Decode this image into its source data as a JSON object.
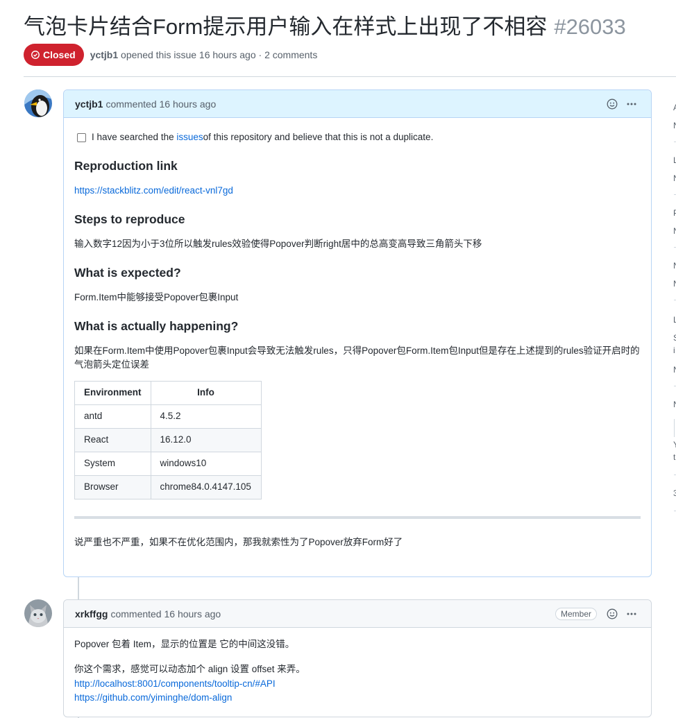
{
  "issue": {
    "title": "气泡卡片结合Form提示用户输入在样式上出现了不相容",
    "number": "#26033",
    "state": "Closed",
    "author": "yctjb1",
    "opened_text": "opened this issue 16 hours ago · 2 comments"
  },
  "comment1": {
    "author": "yctjb1",
    "time_text": "commented 16 hours ago",
    "checkbox": {
      "before": "I have searched the ",
      "link": "issues",
      "after": " of this repository and believe that this is not a duplicate."
    },
    "h_repro": "Reproduction link",
    "repro_link": "https://stackblitz.com/edit/react-vnl7gd",
    "h_steps": "Steps to reproduce",
    "steps_text": "输入数字12因为小于3位所以触发rules效验使得Popover判断right居中的总高变高导致三角箭头下移",
    "h_expected": "What is expected?",
    "expected_text": "Form.Item中能够接受Popover包裹Input",
    "h_actual": "What is actually happening?",
    "actual_text": "如果在Form.Item中使用Popover包裹Input会导致无法触发rules，只得Popover包Form.Item包Input但是存在上述提到的rules验证开启时的气泡箭头定位误差",
    "table": {
      "headers": [
        "Environment",
        "Info"
      ],
      "rows": [
        [
          "antd",
          "4.5.2"
        ],
        [
          "React",
          "16.12.0"
        ],
        [
          "System",
          "windows10"
        ],
        [
          "Browser",
          "chrome84.0.4147.105"
        ]
      ]
    },
    "footer_text": "说严重也不严重，如果不在优化范围内，那我就索性为了Popover放弃Form好了"
  },
  "comment2": {
    "author": "xrkffgg",
    "time_text": "commented 16 hours ago",
    "badge": "Member",
    "line1": "Popover 包着 Item，显示的位置是 它的中间这没错。",
    "line2": "你这个需求，感觉可以动态加个 align 设置 offset 来弄。",
    "link1": "http://localhost:8001/components/tooltip-cn/#API",
    "link2": "https://github.com/yiminghe/dom-align"
  },
  "sidebar_letters": [
    "A",
    "N",
    "L",
    "N",
    "P",
    "N",
    "N",
    "N",
    "L",
    "S",
    "i",
    "N",
    "N",
    "Y",
    "t",
    "3"
  ],
  "icons": [
    "closed-issue-icon",
    "smiley-icon",
    "kebab-horizontal-icon"
  ],
  "colors": {
    "closed_red": "#cf222e",
    "link_blue": "#0969da",
    "author_header_bg": "#ddf4ff",
    "border": "#d0d7de"
  }
}
